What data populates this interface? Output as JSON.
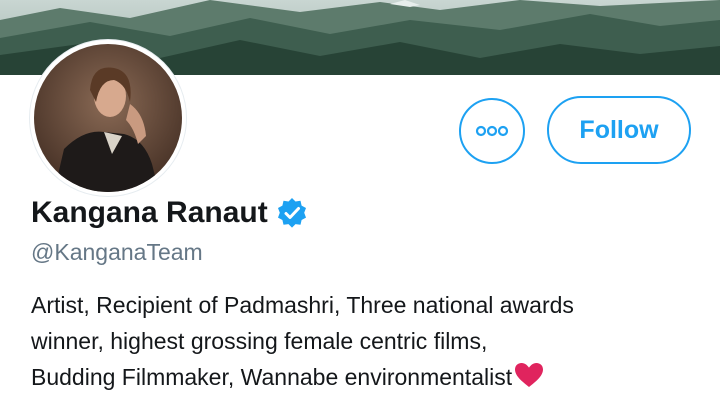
{
  "profile": {
    "display_name": "Kangana Ranaut",
    "handle": "@KanganaTeam",
    "verified": true,
    "bio_lines": [
      "Artist, Recipient of Padmashri, Three national awards",
      "winner, highest grossing female centric films,",
      "Budding Filmmaker, Wannabe environmentalist"
    ],
    "bio_trailing_icon": "red-heart-icon"
  },
  "actions": {
    "more_icon": "more-options-icon",
    "follow_label": "Follow"
  },
  "colors": {
    "accent": "#1da1f2",
    "text": "#14171a",
    "secondary_text": "#657786",
    "heart": "#e0245e"
  }
}
